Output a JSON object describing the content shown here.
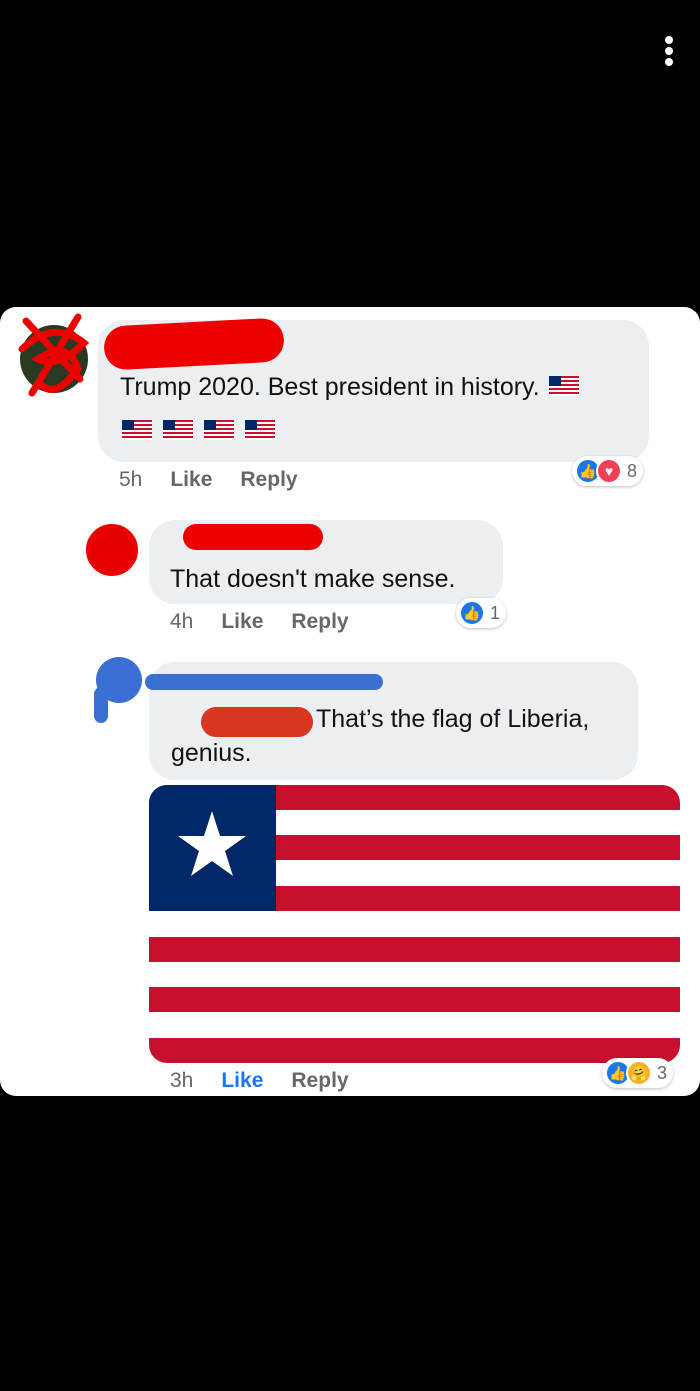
{
  "colors": {
    "facebook_blue": "#1877f2",
    "bubble_grey": "#eceff2",
    "redact_red": "#ee0000",
    "redact_blue": "#3a6fd4",
    "liberia_red": "#c8102e",
    "liberia_blue": "#002868"
  },
  "header": {
    "menu_icon": "vertical-ellipsis-icon"
  },
  "comments": [
    {
      "text": "Trump 2020. Best president in history.",
      "flags": [
        "liberia-flag-emoji",
        "liberia-flag-emoji",
        "liberia-flag-emoji",
        "liberia-flag-emoji",
        "liberia-flag-emoji"
      ],
      "time": "5h",
      "like_label": "Like",
      "reply_label": "Reply",
      "reactions": [
        "like",
        "love"
      ],
      "reaction_count": "8"
    },
    {
      "text": "That doesn't make sense.",
      "time": "4h",
      "like_label": "Like",
      "reply_label": "Reply",
      "reactions": [
        "like"
      ],
      "reaction_count": "1"
    },
    {
      "text_line1": "That’s the flag of Liberia,",
      "text_line2": "genius.",
      "image": "liberia-flag-image",
      "time": "3h",
      "like_label": "Like",
      "like_active": true,
      "reply_label": "Reply",
      "reactions": [
        "like",
        "care"
      ],
      "reaction_count": "3"
    }
  ]
}
